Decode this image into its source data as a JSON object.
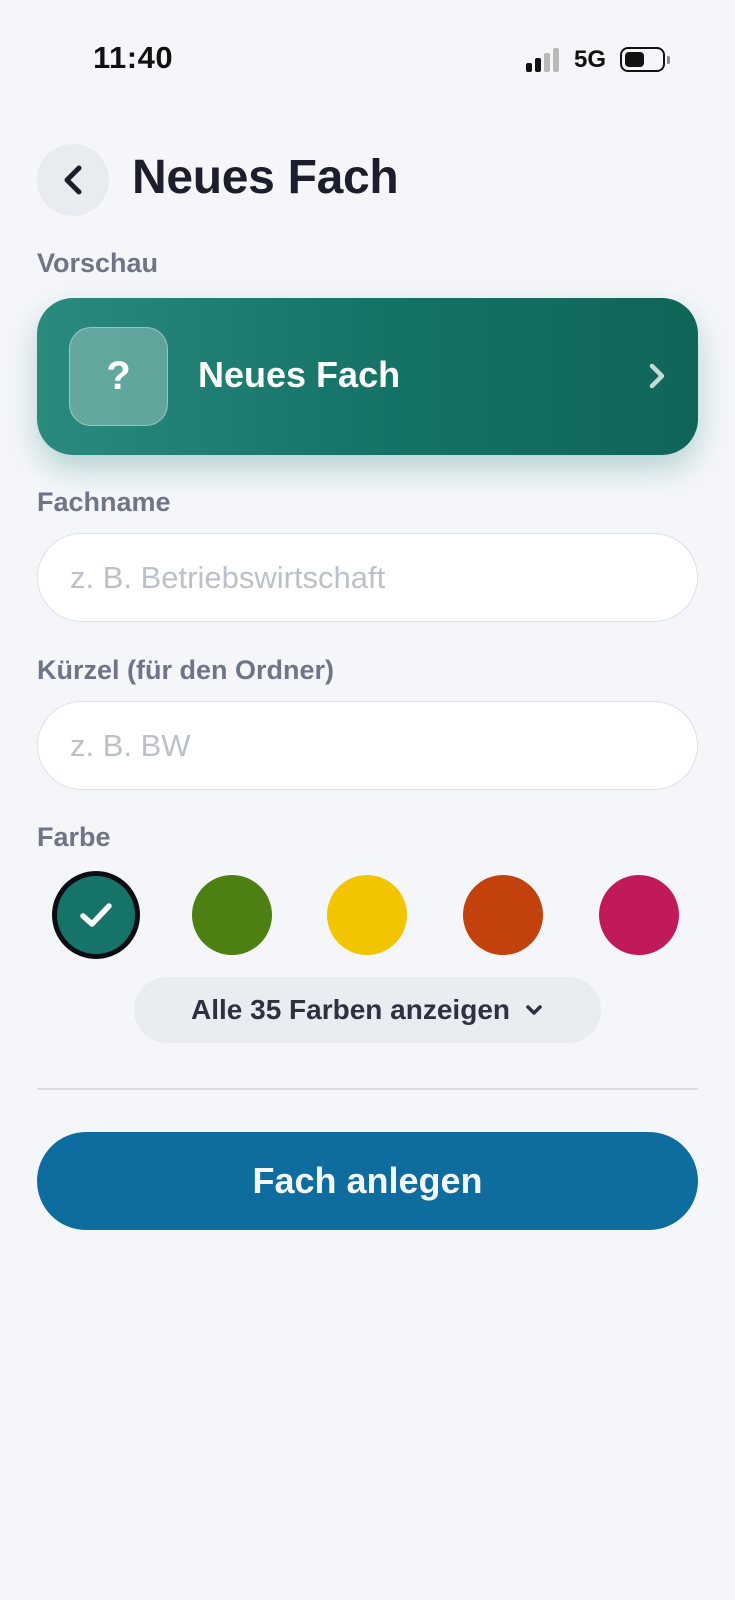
{
  "status_bar": {
    "time": "11:40",
    "network": "5G",
    "battery_level": 0.55
  },
  "header": {
    "title": "Neues Fach",
    "back_icon": "chevron-left-icon"
  },
  "preview": {
    "section_label": "Vorschau",
    "icon_glyph": "?",
    "name": "Neues Fach",
    "chevron_icon": "chevron-right-icon",
    "color": "#157467"
  },
  "form": {
    "name_label": "Fachname",
    "name_value": "",
    "name_placeholder": "z. B. Betriebswirtschaft",
    "short_label": "Kürzel (für den Ordner)",
    "short_value": "",
    "short_placeholder": "z. B. BW"
  },
  "colors": {
    "section_label": "Farbe",
    "swatches": [
      {
        "color": "#157467",
        "selected": true
      },
      {
        "color": "#4d7f12",
        "selected": false
      },
      {
        "color": "#f3c400",
        "selected": false
      },
      {
        "color": "#c3410c",
        "selected": false
      },
      {
        "color": "#c01a5b",
        "selected": false
      }
    ],
    "show_all_label": "Alle 35 Farben anzeigen",
    "show_all_icon": "chevron-down-icon"
  },
  "actions": {
    "create_label": "Fach anlegen",
    "create_color": "#0e6d9e"
  }
}
